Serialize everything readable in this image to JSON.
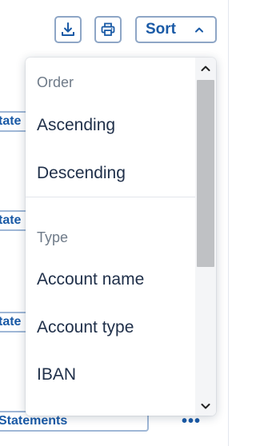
{
  "toolbar": {
    "download_icon": "download-icon",
    "print_icon": "printer-icon",
    "sort_label": "Sort",
    "sort_icon": "chevron-up-icon"
  },
  "background": {
    "chip_label": "Statements",
    "chip_visible_fragment": "tate",
    "more_icon": "ellipsis-icon",
    "more_text": "•••"
  },
  "dropdown": {
    "groups": [
      {
        "label": "Order",
        "options": [
          "Ascending",
          "Descending"
        ]
      },
      {
        "label": "Type",
        "options": [
          "Account name",
          "Account type",
          "IBAN"
        ]
      }
    ]
  },
  "colors": {
    "accent": "#1a5aa6",
    "button_border": "#8ea6c6",
    "option_text": "#20304a",
    "group_label_text": "#6f7b89",
    "scroll_thumb": "#bfc1c4"
  }
}
